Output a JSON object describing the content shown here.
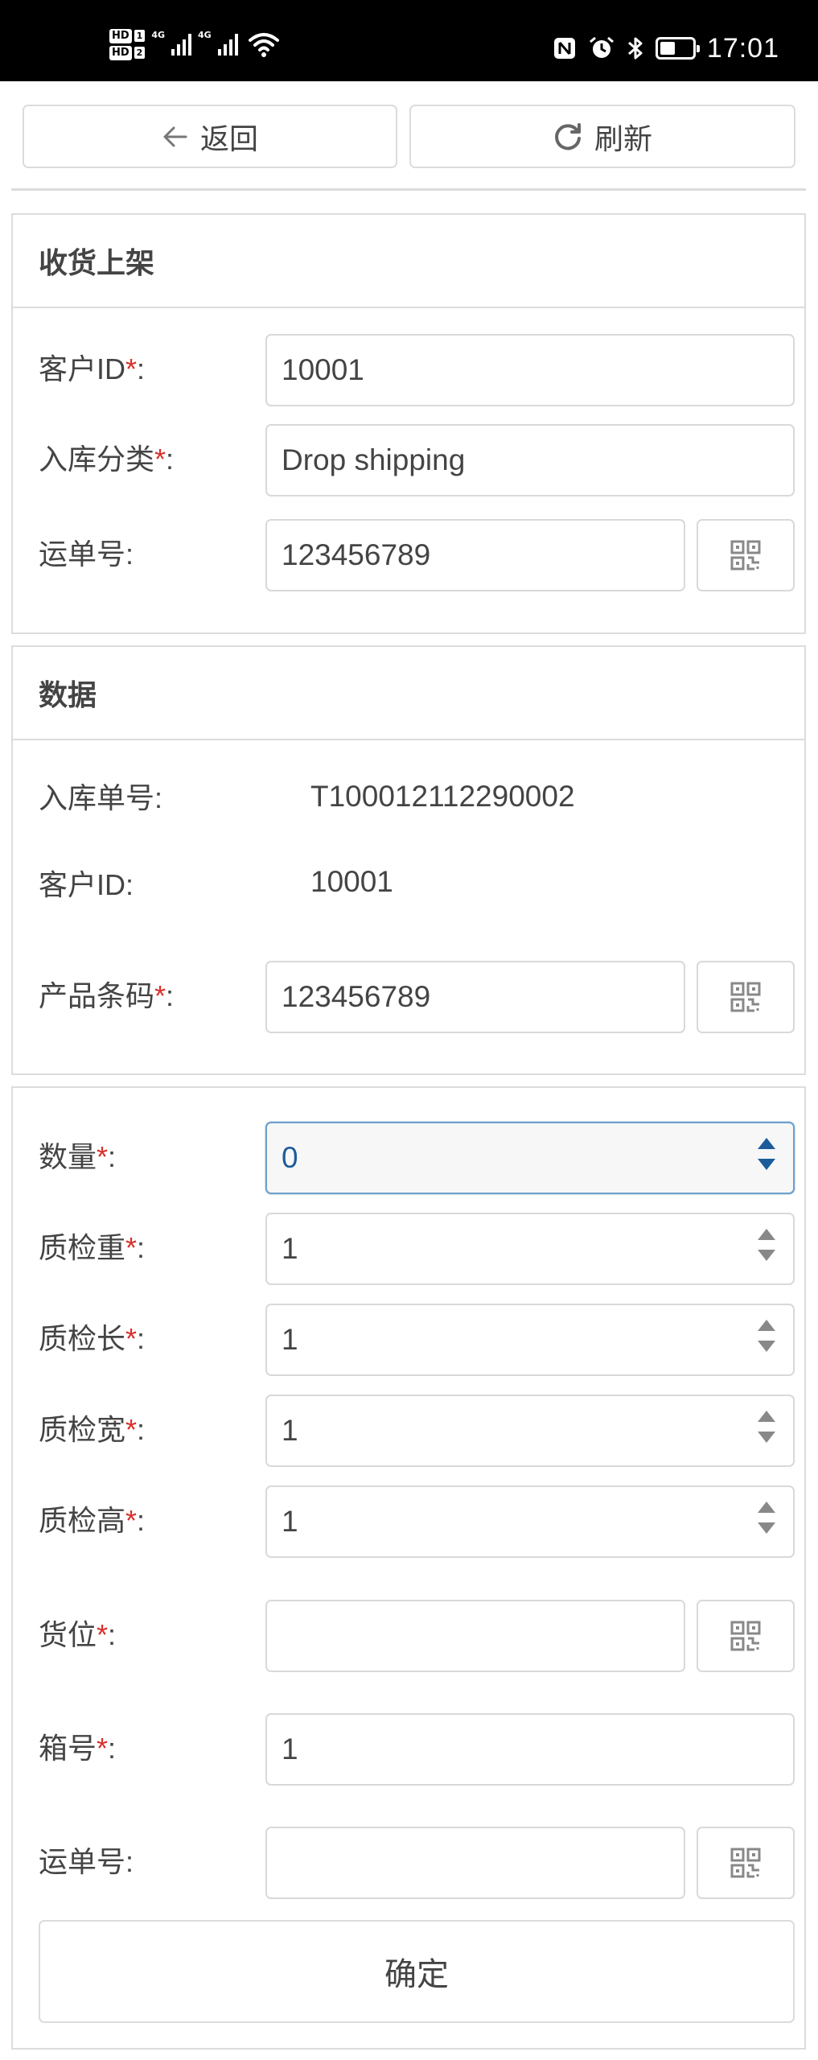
{
  "status_bar": {
    "hd1": "HD",
    "sim1": "1",
    "hd2": "HD",
    "sim2": "2",
    "net1": "4G",
    "net2": "4G",
    "time": "17:01",
    "icons": [
      "nfc-icon",
      "alarm-icon",
      "bluetooth-icon",
      "battery-icon"
    ]
  },
  "toolbar": {
    "back_label": "返回",
    "refresh_label": "刷新"
  },
  "receive_panel": {
    "title": "收货上架",
    "customer_id_label": "客户ID",
    "customer_id_value": "10001",
    "category_label": "入库分类",
    "category_value": "Drop shipping",
    "waybill_label": "运单号:",
    "waybill_value": "123456789"
  },
  "data_panel": {
    "title": "数据",
    "inbound_no_label": "入库单号:",
    "inbound_no_value": "T100012112290002",
    "customer_id_label": "客户ID:",
    "customer_id_value": "10001",
    "barcode_label": "产品条码",
    "barcode_value": "123456789"
  },
  "detail_panel": {
    "qty_label": "数量",
    "qty_value": "0",
    "weight_label": "质检重",
    "weight_value": "1",
    "length_label": "质检长",
    "length_value": "1",
    "width_label": "质检宽",
    "width_value": "1",
    "height_label": "质检高",
    "height_value": "1",
    "location_label": "货位",
    "location_value": "",
    "box_label": "箱号",
    "box_value": "1",
    "waybill_label": "运单号:",
    "waybill_value": "",
    "confirm_label": "确定"
  },
  "colors": {
    "required": "#d9302c",
    "active_border": "#6fa0cc",
    "active_text": "#1c5c9c",
    "border": "#dcdcdc"
  },
  "required_mark": "*",
  "colon": ":"
}
